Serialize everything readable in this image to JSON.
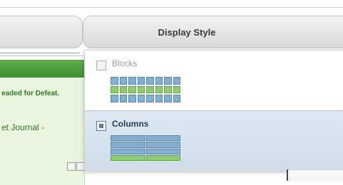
{
  "tabs": {
    "display_style": "Display Style"
  },
  "left_panel": {
    "headline_fragment": "eaded for Defeat.",
    "journal_fragment": "et Journal -"
  },
  "display_style_menu": {
    "options": [
      {
        "label": "Blocks",
        "selected": false
      },
      {
        "label": "Columns",
        "selected": true
      }
    ]
  },
  "colors": {
    "selected_bg": "#d6e3ee",
    "label_selected": "#1f3e5a",
    "label_unselected": "#9e9e9e",
    "preview_blue": "#84aecf",
    "preview_green": "#8fcb72",
    "green_bar": "#4f9f3f"
  }
}
